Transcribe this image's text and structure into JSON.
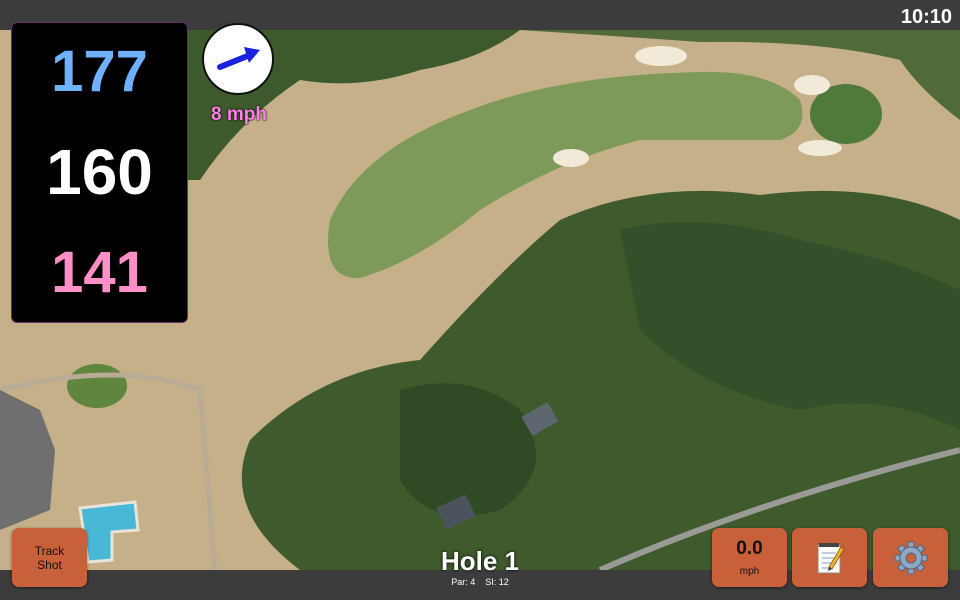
{
  "status_bar": {
    "time": "10:10"
  },
  "yardages": {
    "back": "177",
    "middle": "160",
    "front": "141"
  },
  "wind": {
    "speed": "8 mph",
    "icon": "wind-arrow-icon"
  },
  "hole": {
    "title": "Hole 1",
    "par": "Par: 4",
    "stroke_index": "SI: 12"
  },
  "buttons": {
    "track_shot_line1": "Track",
    "track_shot_line2": "Shot",
    "speed_value": "0.0",
    "speed_unit": "mph",
    "notes_icon": "notepad-icon",
    "settings_icon": "gear-icon"
  },
  "colors": {
    "button_bg": "#c8613a",
    "back_yardage": "#6fb1ff",
    "front_yardage": "#ff8fc6",
    "wind_text": "#ff7fe3"
  }
}
